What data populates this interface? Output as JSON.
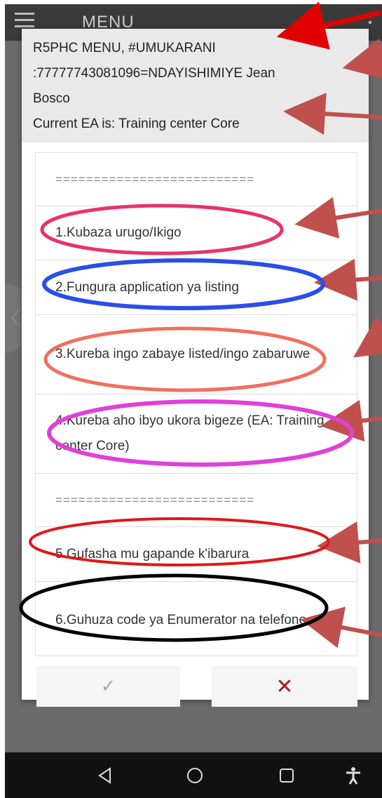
{
  "appbar": {
    "title": "MENU"
  },
  "dialog": {
    "header": {
      "line1": "R5PHC MENU, #UMUKARANI",
      "line2": ":77777743081096=NDAYISHIMIYE Jean",
      "line3": "Bosco",
      "line4": "Current EA is: Training center Core"
    },
    "items": [
      {
        "label": "=========================="
      },
      {
        "label": "1.Kubaza urugo/Ikigo"
      },
      {
        "label": "2.Fungura application ya listing"
      },
      {
        "label": "3.Kureba ingo zabaye listed/ingo zabaruwe"
      },
      {
        "label": "4.Kureba aho ibyo ukora bigeze (EA: Training center Core)"
      },
      {
        "label": "=========================="
      },
      {
        "label": "5.Gufasha mu gapande k'ibarura"
      },
      {
        "label": "6.Guhuza code ya Enumerator na telefone"
      }
    ],
    "buttons": {
      "ok": "✓",
      "cancel": "✕"
    }
  },
  "colors": {
    "arrow": "#c0504d",
    "arrow_top": "#e00000",
    "circle_item1": "#e8336c",
    "circle_item2": "#2a4ee8",
    "circle_item3": "#f07060",
    "circle_item4": "#e040d8",
    "circle_item5": "#e01818",
    "circle_item6": "#000000",
    "cancel": "#a02020"
  }
}
